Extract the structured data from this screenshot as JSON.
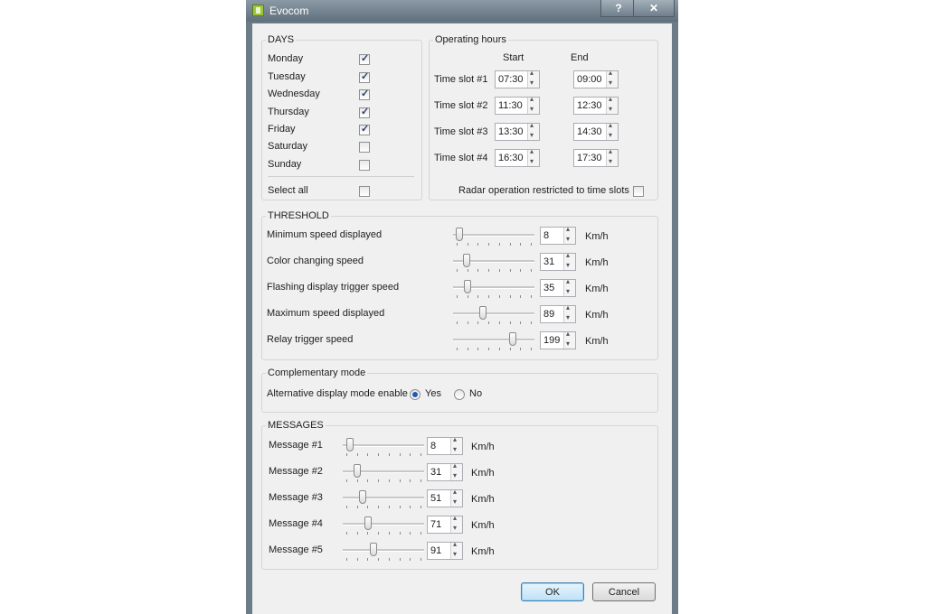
{
  "window": {
    "title": "Evocom",
    "help_label": "?",
    "close_label": "✕"
  },
  "days": {
    "title": "DAYS",
    "items": [
      {
        "label": "Monday",
        "checked": true
      },
      {
        "label": "Tuesday",
        "checked": true
      },
      {
        "label": "Wednesday",
        "checked": true
      },
      {
        "label": "Thursday",
        "checked": true
      },
      {
        "label": "Friday",
        "checked": true
      },
      {
        "label": "Saturday",
        "checked": false
      },
      {
        "label": "Sunday",
        "checked": false
      }
    ],
    "select_all": {
      "label": "Select all",
      "checked": false
    }
  },
  "operating_hours": {
    "title": "Operating hours",
    "start_header": "Start",
    "end_header": "End",
    "slots": [
      {
        "label": "Time slot #1",
        "start": "07:30",
        "end": "09:00"
      },
      {
        "label": "Time slot #2",
        "start": "11:30",
        "end": "12:30"
      },
      {
        "label": "Time slot #3",
        "start": "13:30",
        "end": "14:30"
      },
      {
        "label": "Time slot #4",
        "start": "16:30",
        "end": "17:30"
      }
    ],
    "restricted": {
      "label": "Radar operation restricted to time slots",
      "checked": false
    }
  },
  "threshold": {
    "title": "THRESHOLD",
    "rows": [
      {
        "label": "Minimum speed displayed",
        "value": "8",
        "unit": "Km/h",
        "slider_fraction": 0.04
      },
      {
        "label": "Color changing speed",
        "value": "31",
        "unit": "Km/h",
        "slider_fraction": 0.13
      },
      {
        "label": "Flashing display trigger speed",
        "value": "35",
        "unit": "Km/h",
        "slider_fraction": 0.15
      },
      {
        "label": "Maximum speed displayed",
        "value": "89",
        "unit": "Km/h",
        "slider_fraction": 0.35
      },
      {
        "label": "Relay trigger speed",
        "value": "199",
        "unit": "Km/h",
        "slider_fraction": 0.75
      }
    ]
  },
  "complementary": {
    "title": "Complementary mode",
    "label": "Alternative display mode enable",
    "yes_label": "Yes",
    "no_label": "No",
    "selected": "yes"
  },
  "messages": {
    "title": "MESSAGES",
    "rows": [
      {
        "label": "Message #1",
        "value": "8",
        "unit": "Km/h",
        "slider_fraction": 0.05
      },
      {
        "label": "Message #2",
        "value": "31",
        "unit": "Km/h",
        "slider_fraction": 0.15
      },
      {
        "label": "Message #3",
        "value": "51",
        "unit": "Km/h",
        "slider_fraction": 0.22
      },
      {
        "label": "Message #4",
        "value": "71",
        "unit": "Km/h",
        "slider_fraction": 0.29
      },
      {
        "label": "Message #5",
        "value": "91",
        "unit": "Km/h",
        "slider_fraction": 0.36
      }
    ]
  },
  "buttons": {
    "ok_label": "OK",
    "cancel_label": "Cancel"
  }
}
